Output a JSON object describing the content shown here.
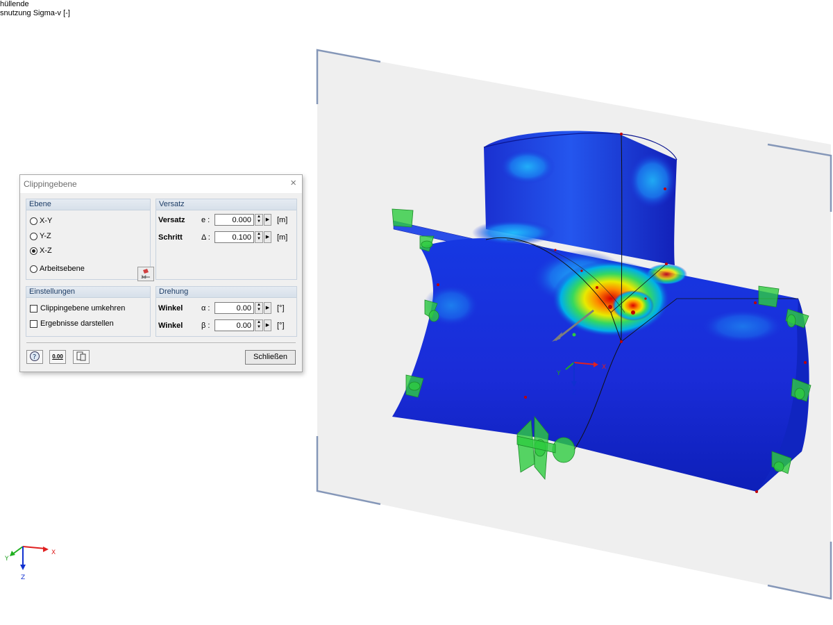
{
  "overlay": {
    "line1": "hüllende",
    "line2": "snutzung Sigma-v [-]"
  },
  "axes_main": {
    "x": "X",
    "y": "Y",
    "z": "Z"
  },
  "axes_scene": {
    "x": "X",
    "y": "Y",
    "z": "Z"
  },
  "dialog": {
    "title": "Clippingebene",
    "close_icon": "×",
    "ebene": {
      "header": "Ebene",
      "options": [
        "X-Y",
        "Y-Z",
        "X-Z",
        "Arbeitsebene"
      ],
      "selected": "X-Z",
      "workplane_button_icon": "workplane-3d-icon"
    },
    "versatz": {
      "header": "Versatz",
      "rows": [
        {
          "label": "Versatz",
          "symbol": "e :",
          "value": "0.000",
          "unit": "[m]"
        },
        {
          "label": "Schritt",
          "symbol": "Δ :",
          "value": "0.100",
          "unit": "[m]"
        }
      ]
    },
    "einstellungen": {
      "header": "Einstellungen",
      "checkboxes": [
        {
          "label": "Clippingebene umkehren",
          "checked": false
        },
        {
          "label": "Ergebnisse darstellen",
          "checked": false
        }
      ]
    },
    "drehung": {
      "header": "Drehung",
      "rows": [
        {
          "label": "Winkel",
          "symbol": "α :",
          "value": "0.00",
          "unit": "[°]"
        },
        {
          "label": "Winkel",
          "symbol": "β :",
          "value": "0.00",
          "unit": "[°]"
        }
      ]
    },
    "footer": {
      "help_icon": "help-icon",
      "units_icon": "units-icon",
      "copy_icon": "copy-settings-icon",
      "units_text": "0.00",
      "close_label": "Schließen"
    }
  },
  "colors": {
    "plane_fill": "#efefef",
    "plane_frame": "#8597b8",
    "model_blue": "#1a2cd8",
    "support_green": "#2ecc40",
    "dialog_group_header": "#1d3d66"
  }
}
